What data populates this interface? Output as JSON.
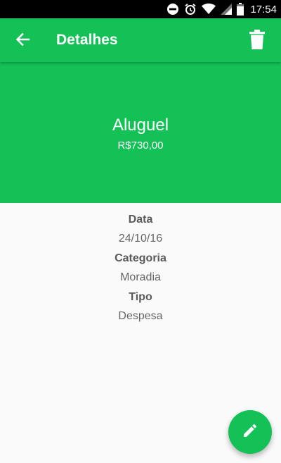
{
  "status_bar": {
    "time": "17:54",
    "icons": [
      "do-not-disturb-icon",
      "alarm-icon",
      "wifi-icon",
      "signal-icon",
      "battery-icon"
    ]
  },
  "app_bar": {
    "title": "Detalhes",
    "back_icon": "arrow-back-icon",
    "delete_icon": "trash-icon"
  },
  "transaction": {
    "name": "Aluguel",
    "amount": "R$730,00"
  },
  "details": {
    "date_label": "Data",
    "date_value": "24/10/16",
    "category_label": "Categoria",
    "category_value": "Moradia",
    "type_label": "Tipo",
    "type_value": "Despesa"
  },
  "fab": {
    "icon": "edit-pencil-icon"
  },
  "colors": {
    "primary": "#14c157",
    "background": "#fafafa",
    "status_bar": "#000000"
  }
}
